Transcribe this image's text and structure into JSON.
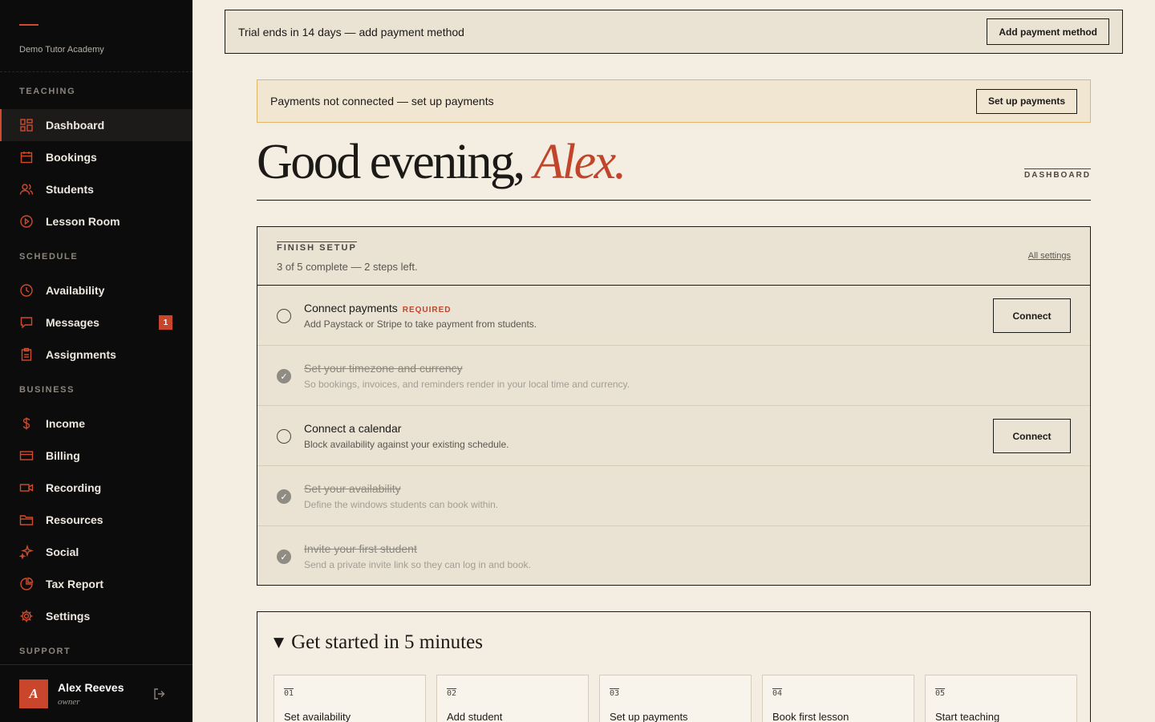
{
  "sidebar": {
    "brand": "Demo Tutor Academy",
    "sections": {
      "teaching": "TEACHING",
      "schedule": "SCHEDULE",
      "business": "BUSINESS",
      "support": "SUPPORT"
    },
    "items": {
      "dashboard": "Dashboard",
      "bookings": "Bookings",
      "students": "Students",
      "lesson_room": "Lesson Room",
      "availability": "Availability",
      "messages": "Messages",
      "messages_badge": "1",
      "assignments": "Assignments",
      "income": "Income",
      "billing": "Billing",
      "recording": "Recording",
      "resources": "Resources",
      "social": "Social",
      "tax_report": "Tax Report",
      "settings": "Settings"
    },
    "user": {
      "initial": "A",
      "name": "Alex Reeves",
      "role": "owner"
    }
  },
  "trial_banner": {
    "text": "Trial ends in 14 days — add payment method",
    "button": "Add payment method"
  },
  "payments_banner": {
    "text": "Payments not connected — set up payments",
    "button": "Set up payments"
  },
  "greeting": {
    "prefix": "Good evening, ",
    "name": "Alex.",
    "breadcrumb": "DASHBOARD"
  },
  "setup": {
    "eyebrow": "FINISH SETUP",
    "progress": "3 of 5 complete — 2 steps left.",
    "link": "All settings",
    "steps": [
      {
        "title": "Connect payments",
        "tag": "REQUIRED",
        "desc": "Add Paystack or Stripe to take payment from students.",
        "button": "Connect"
      },
      {
        "title": "Set your timezone and currency",
        "desc": "So bookings, invoices, and reminders render in your local time and currency."
      },
      {
        "title": "Connect a calendar",
        "desc": "Block availability against your existing schedule.",
        "button": "Connect"
      },
      {
        "title": "Set your availability",
        "desc": "Define the windows students can book within."
      },
      {
        "title": "Invite your first student",
        "desc": "Send a private invite link so they can log in and book."
      }
    ]
  },
  "get_started": {
    "title": "Get started in 5 minutes",
    "tiles": [
      {
        "num": "01",
        "label": "Set availability"
      },
      {
        "num": "02",
        "label": "Add student"
      },
      {
        "num": "03",
        "label": "Set up payments"
      },
      {
        "num": "04",
        "label": "Book first lesson"
      },
      {
        "num": "05",
        "label": "Start teaching"
      }
    ]
  },
  "colors": {
    "accent": "#c9452b",
    "sidebar_bg": "#0d0c0c",
    "page_bg": "#f4ede1",
    "card_bg": "#eae3d4",
    "warning_border": "#e0b765"
  }
}
